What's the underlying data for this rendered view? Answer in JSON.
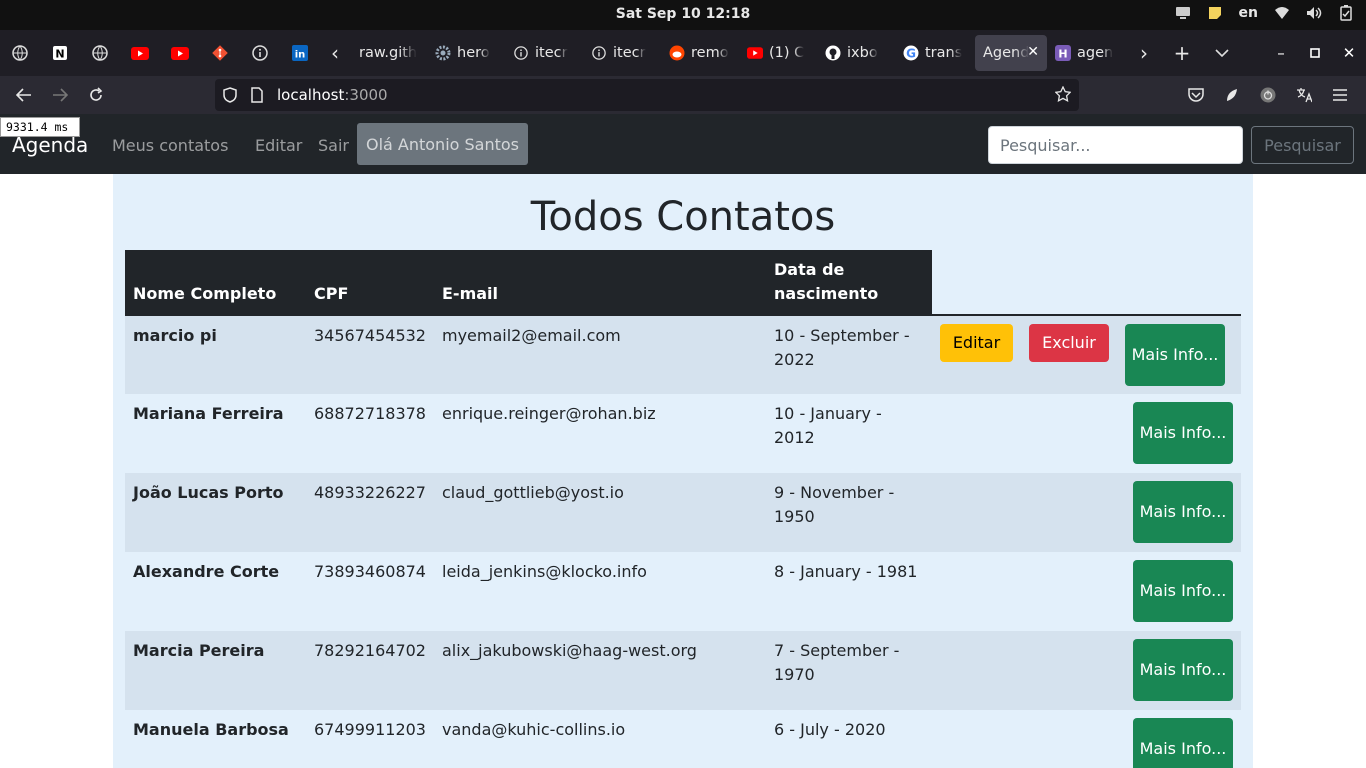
{
  "system": {
    "datetime": "Sat Sep 10  12:18",
    "language": "en"
  },
  "browser": {
    "tabs": [
      {
        "title": "raw.gith",
        "icon": "none-icon"
      },
      {
        "title": "hero",
        "icon": "gear-icon"
      },
      {
        "title": "itecr",
        "icon": "info-icon"
      },
      {
        "title": "itecr",
        "icon": "info-icon"
      },
      {
        "title": "remo",
        "icon": "reddit-icon"
      },
      {
        "title": "(1) C",
        "icon": "youtube-icon"
      },
      {
        "title": "ixbo",
        "icon": "github-icon"
      },
      {
        "title": "trans",
        "icon": "google-icon"
      },
      {
        "title": "Agend",
        "icon": "none-icon",
        "active": true
      },
      {
        "title": "agen",
        "icon": "heroku-icon"
      }
    ],
    "url_host": "localhost",
    "url_port": ":3000",
    "timing": "9331.4 ms"
  },
  "navbar": {
    "brand": "Agenda",
    "links": [
      "Meus contatos",
      "Editar",
      "Sair"
    ],
    "greeting": "Olá Antonio Santos",
    "search_placeholder": "Pesquisar...",
    "search_button": "Pesquisar"
  },
  "page": {
    "title": "Todos Contatos",
    "columns": [
      "Nome Completo",
      "CPF",
      "E-mail",
      "Data de nascimento"
    ],
    "edit_label": "Editar",
    "delete_label": "Excluir",
    "info_label": "Mais Info...",
    "rows": [
      {
        "name": "marcio pi",
        "cpf": "34567454532",
        "email": "myemail2@email.com",
        "birth": "10 - September - 2022",
        "owned": true
      },
      {
        "name": "Mariana Ferreira",
        "cpf": "68872718378",
        "email": "enrique.reinger@rohan.biz",
        "birth": "10 - January - 2012",
        "owned": false
      },
      {
        "name": "João Lucas Porto",
        "cpf": "48933226227",
        "email": "claud_gottlieb@yost.io",
        "birth": "9 - November - 1950",
        "owned": false
      },
      {
        "name": "Alexandre Corte",
        "cpf": "73893460874",
        "email": "leida_jenkins@klocko.info",
        "birth": "8 - January - 1981",
        "owned": false
      },
      {
        "name": "Marcia Pereira",
        "cpf": "78292164702",
        "email": "alix_jakubowski@haag-west.org",
        "birth": "7 - September - 1970",
        "owned": false
      },
      {
        "name": "Manuela Barbosa",
        "cpf": "67499911203",
        "email": "vanda@kuhic-collins.io",
        "birth": "6 - July - 2020",
        "owned": false
      }
    ]
  }
}
